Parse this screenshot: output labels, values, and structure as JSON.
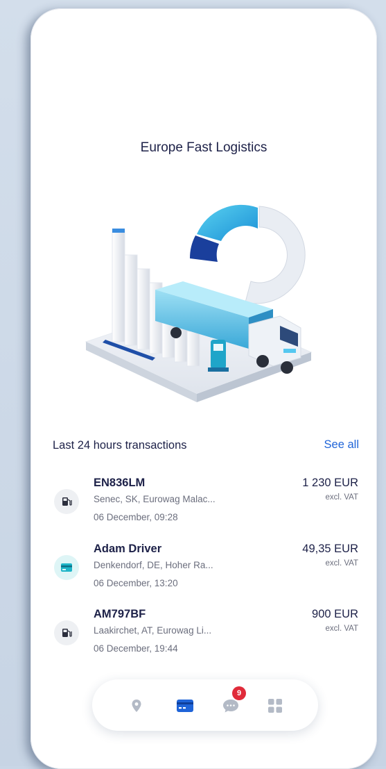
{
  "header": {
    "company_name": "Europe Fast Logistics"
  },
  "illustration": {
    "name": "logistics-dashboard-illustration"
  },
  "transactions": {
    "title": "Last 24 hours transactions",
    "see_all_label": "See all",
    "items": [
      {
        "name": "EN836LM",
        "location": "Senec, SK, Eurowag Malac...",
        "date": "06 December, 09:28",
        "amount": "1 230 EUR",
        "vat_note": "excl. VAT",
        "icon": "fuel-pump-icon"
      },
      {
        "name": "Adam Driver",
        "location": "Denkendorf, DE, Hoher Ra...",
        "date": "06 December, 13:20",
        "amount": "49,35 EUR",
        "vat_note": "excl. VAT",
        "icon": "card-icon"
      },
      {
        "name": "AM797BF",
        "location": "Laakirchet, AT, Eurowag Li...",
        "date": "06 December, 19:44",
        "amount": "900 EUR",
        "vat_note": "excl. VAT",
        "icon": "fuel-pump-icon"
      }
    ]
  },
  "navbar": {
    "items": [
      {
        "icon": "location-pin-icon",
        "active": false
      },
      {
        "icon": "card-icon",
        "active": true
      },
      {
        "icon": "chat-icon",
        "active": false,
        "badge": "9"
      },
      {
        "icon": "grid-icon",
        "active": false
      }
    ]
  },
  "colors": {
    "accent": "#1f64d8",
    "text_primary": "#1d2148",
    "text_secondary": "#6b6e7d",
    "badge": "#e02b3a",
    "card_icon_bg": "#def5f6"
  }
}
